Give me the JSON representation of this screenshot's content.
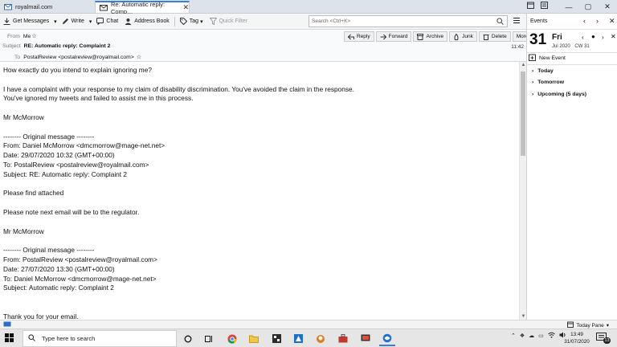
{
  "tabs": [
    {
      "label": "royalmail.com",
      "icon": "mail-folder-icon"
    },
    {
      "label": "Re: Automatic reply: Comp…",
      "icon": "envelope-icon"
    }
  ],
  "toolbar": {
    "get_messages": "Get Messages",
    "write": "Write",
    "chat": "Chat",
    "address_book": "Address Book",
    "tag": "Tag",
    "quick_filter": "Quick Filter",
    "search_placeholder": "Search <Ctrl+K>"
  },
  "message": {
    "from_label": "From",
    "from_value": "Me",
    "subject_label": "Subject",
    "subject_value": "RE: Automatic reply: Complaint 2",
    "to_label": "To",
    "to_value": "PostalReview <postalreview@royalmail.com>",
    "time": "11:42",
    "actions": {
      "reply": "Reply",
      "forward": "Forward",
      "archive": "Archive",
      "junk": "Junk",
      "delete": "Delete",
      "more": "More"
    },
    "body_lines": [
      "How exactly do you intend to explain ignoring me?",
      "",
      "I have a complaint with your response to my claim of disability discrimination. You've avoided the claim in the response.",
      "You've ignored my tweets and failed to assist me in this process.",
      "",
      "Mr McMorrow",
      "",
      "-------- Original message --------",
      "From: Daniel McMorrow <dmcmorrow@mage-net.net>",
      "Date: 29/07/2020 10:32 (GMT+00:00)",
      "To: PostalReview <postalreview@royalmail.com>",
      "Subject: RE: Automatic reply: Complaint 2",
      "",
      "Please find attached",
      "",
      "Please note next email will be to the regulator.",
      "",
      "Mr McMorrow",
      "",
      "-------- Original message --------",
      "From: PostalReview <postalreview@royalmail.com>",
      "Date: 27/07/2020 13:30 (GMT+00:00)",
      "To: Daniel McMorrow <dmcmorrow@mage-net.net>",
      "Subject: Automatic reply: Complaint 2",
      "",
      "",
      "Thank you for your email."
    ]
  },
  "calendar": {
    "title": "Events",
    "day_number": "31",
    "day_name": "Fri",
    "month_year": "Jul 2020",
    "week": "CW 31",
    "new_event": "New Event",
    "groups": [
      "Today",
      "Tomorrow",
      "Upcoming (5 days)"
    ]
  },
  "statusbar": {
    "today_pane": "Today Pane"
  },
  "taskbar": {
    "search_placeholder": "Type here to search",
    "time": "13:49",
    "date": "31/07/2020",
    "notification_count": "13"
  }
}
